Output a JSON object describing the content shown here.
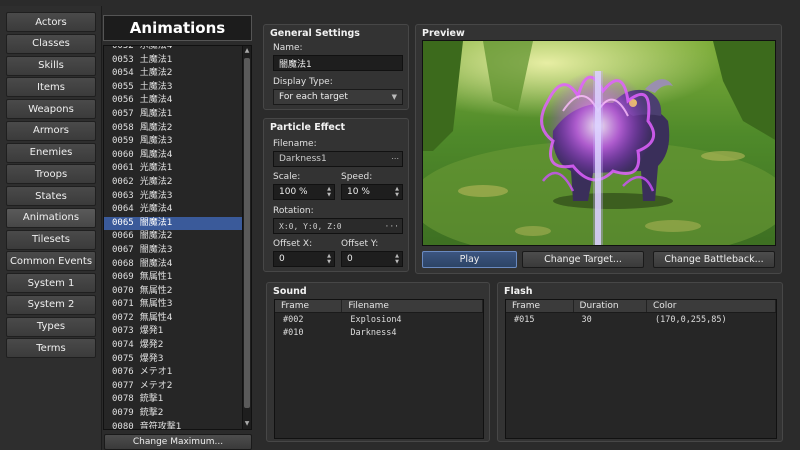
{
  "sidebar": {
    "items": [
      "Actors",
      "Classes",
      "Skills",
      "Items",
      "Weapons",
      "Armors",
      "Enemies",
      "Troops",
      "States",
      "Animations",
      "Tilesets",
      "Common Events",
      "System 1",
      "System 2",
      "Types",
      "Terms"
    ],
    "active_index": 9
  },
  "animation_list": {
    "title": "Animations",
    "items": [
      {
        "id": "0052",
        "name": "水魔法4"
      },
      {
        "id": "0053",
        "name": "土魔法1"
      },
      {
        "id": "0054",
        "name": "土魔法2"
      },
      {
        "id": "0055",
        "name": "土魔法3"
      },
      {
        "id": "0056",
        "name": "土魔法4"
      },
      {
        "id": "0057",
        "name": "風魔法1"
      },
      {
        "id": "0058",
        "name": "風魔法2"
      },
      {
        "id": "0059",
        "name": "風魔法3"
      },
      {
        "id": "0060",
        "name": "風魔法4"
      },
      {
        "id": "0061",
        "name": "光魔法1"
      },
      {
        "id": "0062",
        "name": "光魔法2"
      },
      {
        "id": "0063",
        "name": "光魔法3"
      },
      {
        "id": "0064",
        "name": "光魔法4"
      },
      {
        "id": "0065",
        "name": "闇魔法1"
      },
      {
        "id": "0066",
        "name": "闇魔法2"
      },
      {
        "id": "0067",
        "name": "闇魔法3"
      },
      {
        "id": "0068",
        "name": "闇魔法4"
      },
      {
        "id": "0069",
        "name": "無属性1"
      },
      {
        "id": "0070",
        "name": "無属性2"
      },
      {
        "id": "0071",
        "name": "無属性3"
      },
      {
        "id": "0072",
        "name": "無属性4"
      },
      {
        "id": "0073",
        "name": "爆発1"
      },
      {
        "id": "0074",
        "name": "爆発2"
      },
      {
        "id": "0075",
        "name": "爆発3"
      },
      {
        "id": "0076",
        "name": "メテオ1"
      },
      {
        "id": "0077",
        "name": "メテオ2"
      },
      {
        "id": "0078",
        "name": "銃撃1"
      },
      {
        "id": "0079",
        "name": "銃撃2"
      },
      {
        "id": "0080",
        "name": "音符攻撃1"
      }
    ],
    "selected_index": 13,
    "change_maximum_label": "Change Maximum..."
  },
  "general_settings": {
    "title": "General Settings",
    "name_label": "Name:",
    "name_value": "闇魔法1",
    "display_type_label": "Display Type:",
    "display_type_value": "For each target"
  },
  "particle_effect": {
    "title": "Particle Effect",
    "filename_label": "Filename:",
    "filename_value": "Darkness1",
    "scale_label": "Scale:",
    "scale_value": "100 %",
    "speed_label": "Speed:",
    "speed_value": "10 %",
    "rotation_label": "Rotation:",
    "rotation_value": "X:0, Y:0, Z:0",
    "offset_x_label": "Offset X:",
    "offset_x_value": "0",
    "offset_y_label": "Offset Y:",
    "offset_y_value": "0"
  },
  "preview": {
    "title": "Preview",
    "play_label": "Play",
    "change_target_label": "Change Target...",
    "change_battleback_label": "Change Battleback..."
  },
  "sound": {
    "title": "Sound",
    "columns": [
      "Frame",
      "Filename"
    ],
    "rows": [
      [
        "#002",
        "Explosion4"
      ],
      [
        "#010",
        "Darkness4"
      ]
    ]
  },
  "flash": {
    "title": "Flash",
    "columns": [
      "Frame",
      "Duration",
      "Color"
    ],
    "rows": [
      [
        "#015",
        "30",
        "(170,0,255,85)"
      ]
    ]
  },
  "colors": {
    "selection": "#3a5a9a",
    "effect_purple": "#c050ff"
  }
}
